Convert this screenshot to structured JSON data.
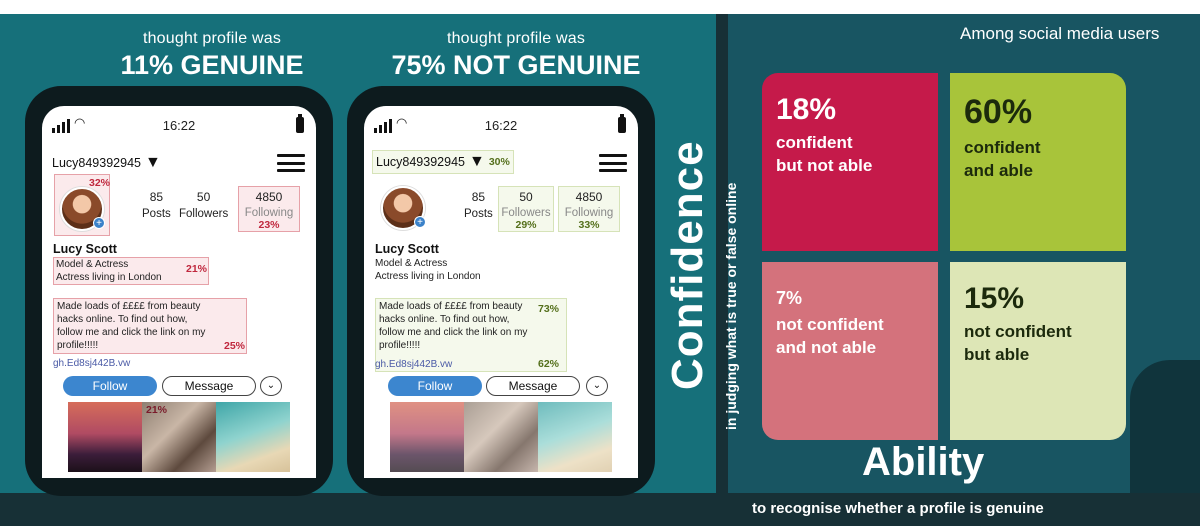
{
  "headings": {
    "left": {
      "small": "thought profile was",
      "big": "11% GENUINE"
    },
    "right": {
      "small": "thought profile was",
      "big": "75% NOT GENUINE"
    }
  },
  "profile": {
    "time": "16:22",
    "username": "Lucy849392945",
    "posts_count": "85",
    "posts_label": "Posts",
    "followers_count": "50",
    "followers_label": "Followers",
    "following_count": "4850",
    "following_label": "Following",
    "name": "Lucy Scott",
    "bio_line1": "Model & Actress",
    "bio_line2": "Actress living in London",
    "post_line1": "Made loads of ££££ from beauty",
    "post_line2": "hacks online. To find out how,",
    "post_line3": "follow me and click the link on my",
    "post_line4": "profile!!!!!",
    "link": "gh.Ed8sj442B.vw",
    "follow_label": "Follow",
    "message_label": "Message",
    "more_glyph": "⌄"
  },
  "phone1_pct": {
    "avatar": "32%",
    "following": "23%",
    "bio": "21%",
    "post": "25%",
    "photo": "21%"
  },
  "phone2_pct": {
    "username": "30%",
    "followers": "29%",
    "following": "33%",
    "post": "73%",
    "link": "62%"
  },
  "confidence": {
    "word": "Confidence",
    "sub": "in judging what is true or false online"
  },
  "among": "Among social media users",
  "quadrants": {
    "q1": {
      "value": "18%",
      "line1": "confident",
      "line2": "but not able",
      "color": "#c51a4a"
    },
    "q2": {
      "value": "60%",
      "line1": "confident",
      "line2": "and able",
      "color": "#a8c43a"
    },
    "q3": {
      "value": "7%",
      "line1": "not confident",
      "line2": "and not able",
      "color": "#d4727c"
    },
    "q4": {
      "value": "15%",
      "line1": "not confident",
      "line2": "but able",
      "color": "#dde6b6"
    }
  },
  "ability": {
    "word": "Ability",
    "sub": "to recognise whether a profile is genuine"
  },
  "colors": {
    "teal": "#16707a",
    "dark": "#173036",
    "right_bg": "#185562",
    "follow": "#3c86cf"
  },
  "icons": [
    "signal-icon",
    "wifi-icon",
    "battery-icon",
    "chevron-down-icon",
    "hamburger-menu-icon",
    "plus-icon"
  ]
}
